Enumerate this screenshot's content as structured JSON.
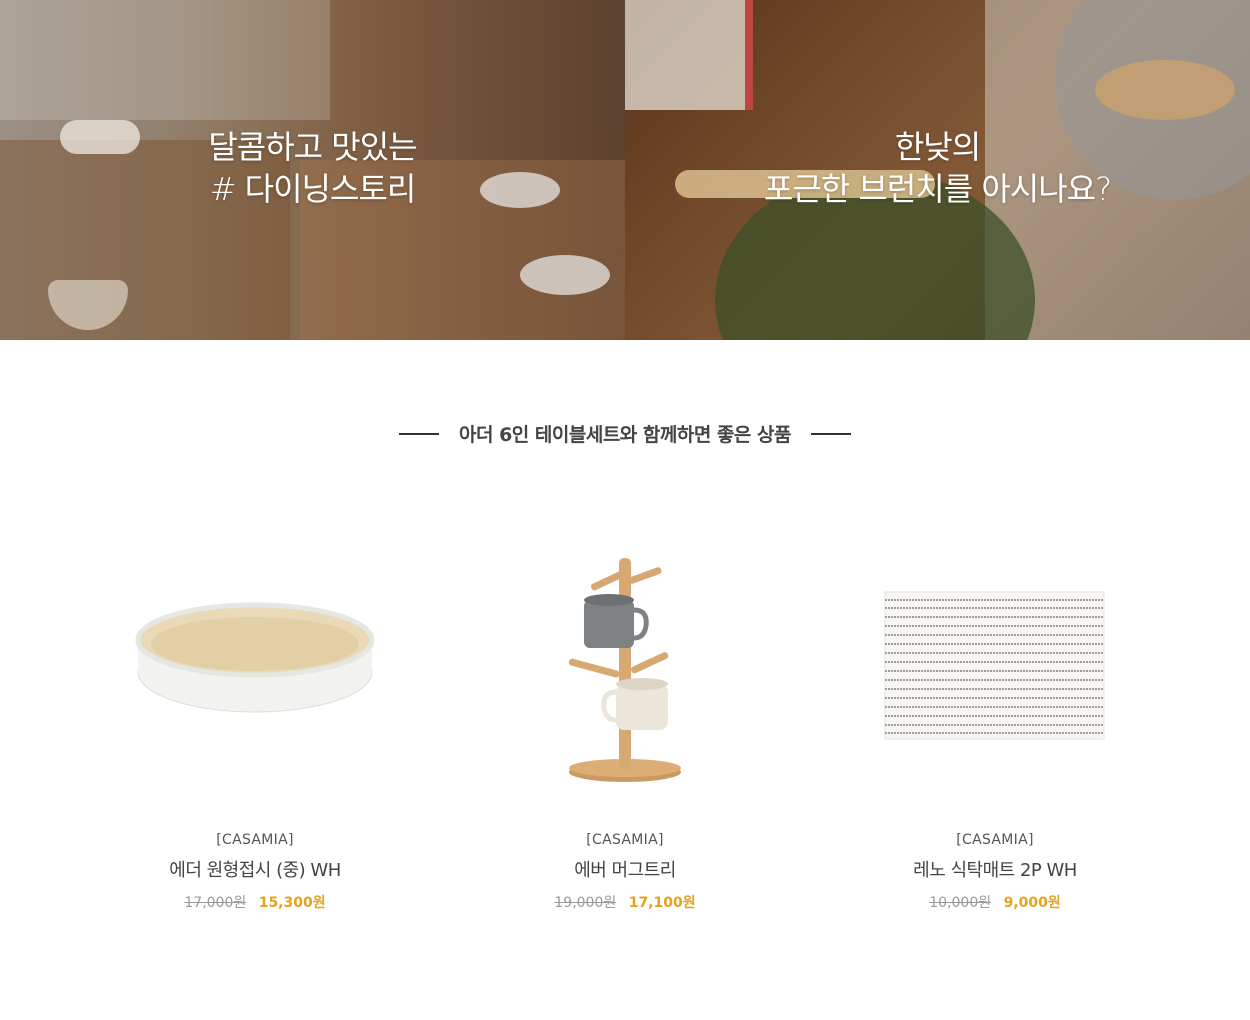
{
  "banners": [
    {
      "lines": [
        "달콤하고 맛있는",
        "# 다이닝스토리"
      ]
    },
    {
      "lines": [
        "한낮의",
        "포근한 브런치를 아시나요?"
      ]
    }
  ],
  "section": {
    "title": "아더 6인 테이블세트와 함께하면 좋은 상품"
  },
  "products": [
    {
      "brand": "[CASAMIA]",
      "name": "에더 원형접시 (중) WH",
      "original_price": "17,000원",
      "sale_price": "15,300원",
      "image_icon": "round-plate-image"
    },
    {
      "brand": "[CASAMIA]",
      "name": "에버 머그트리",
      "original_price": "19,000원",
      "sale_price": "17,100원",
      "image_icon": "mug-tree-image"
    },
    {
      "brand": "[CASAMIA]",
      "name": "레노 식탁매트 2P WH",
      "original_price": "10,000원",
      "sale_price": "9,000원",
      "image_icon": "placemat-image"
    }
  ],
  "colors": {
    "sale_price": "#e5a21d",
    "original_price": "#9a9a9a",
    "title_text": "#444444"
  }
}
